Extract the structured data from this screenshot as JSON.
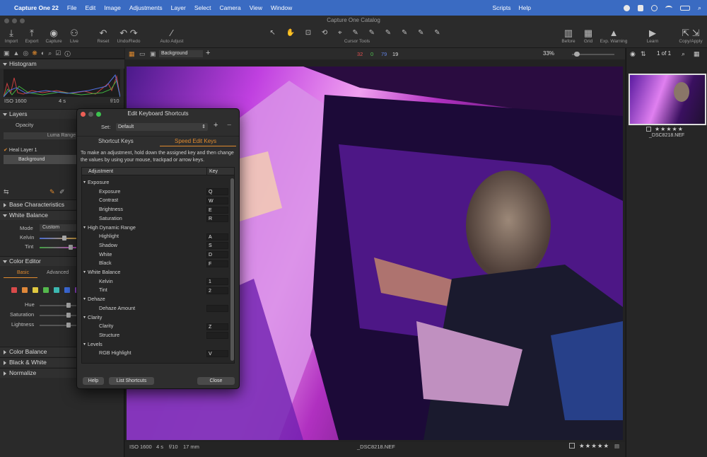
{
  "menubar": {
    "app": "Capture One 22",
    "items": [
      "File",
      "Edit",
      "Image",
      "Adjustments",
      "Layer",
      "Select",
      "Camera",
      "View",
      "Window"
    ],
    "right_items": [
      "Scripts",
      "Help"
    ]
  },
  "window": {
    "title": "Capture One Catalog"
  },
  "toolbar": {
    "import": "Import",
    "export": "Export",
    "capture": "Capture",
    "live": "Live",
    "reset": "Reset",
    "undo_redo": "Undo/Redo",
    "auto_adjust": "Auto Adjust",
    "cursor_tools": "Cursor Tools",
    "before": "Before",
    "grid": "Grid",
    "exp_warning": "Exp. Warning",
    "learn": "Learn",
    "copy_apply": "Copy/Apply"
  },
  "viewer_header": {
    "layer_select": "Background",
    "r": "32",
    "g": "0",
    "b": "79",
    "l": "19",
    "zoom": "33%",
    "count": "1 of 1"
  },
  "left": {
    "histogram": {
      "title": "Histogram",
      "iso": "ISO 1600",
      "shutter": "4 s",
      "aperture": "f/10"
    },
    "layers": {
      "title": "Layers",
      "opacity": "Opacity",
      "luma": "Luma Range",
      "items": [
        "Heal Layer 1",
        "Background"
      ]
    },
    "base": "Base Characteristics",
    "wb": {
      "title": "White Balance",
      "mode_label": "Mode",
      "mode": "Custom",
      "kelvin": "Kelvin",
      "tint": "Tint"
    },
    "color_editor": {
      "title": "Color Editor",
      "tabs": [
        "Basic",
        "Advanced"
      ],
      "hue": "Hue",
      "saturation": "Saturation",
      "lightness": "Lightness"
    },
    "color_balance": "Color Balance",
    "bw": "Black & White",
    "normalize": "Normalize"
  },
  "swatches": [
    "#d94a4a",
    "#e0883a",
    "#e0c840",
    "#54b84c",
    "#3cb8b0",
    "#3c6ad8",
    "#9a4ad8"
  ],
  "status": {
    "iso": "ISO 1600",
    "shutter": "4 s",
    "aperture": "f/10",
    "focal": "17 mm",
    "filename": "_DSC8218.NEF"
  },
  "thumb": {
    "filename": "_DSC8218.NEF",
    "stars": "★★★★★"
  },
  "dialog": {
    "title": "Edit Keyboard Shortcuts",
    "set_label": "Set:",
    "set_value": "Default",
    "tab1": "Shortcut Keys",
    "tab2": "Speed Edit Keys",
    "desc": "To make an adjustment, hold down the assigned key and then change the values by using your mouse, trackpad or arrow keys.",
    "col_adj": "Adjustment",
    "col_key": "Key",
    "rows": [
      {
        "label": "Exposure",
        "group": true,
        "key": ""
      },
      {
        "label": "Exposure",
        "key": "Q"
      },
      {
        "label": "Contrast",
        "key": "W"
      },
      {
        "label": "Brightness",
        "key": "E"
      },
      {
        "label": "Saturation",
        "key": "R"
      },
      {
        "label": "High Dynamic Range",
        "group": true,
        "key": ""
      },
      {
        "label": "Highlight",
        "key": "A"
      },
      {
        "label": "Shadow",
        "key": "S"
      },
      {
        "label": "White",
        "key": "D"
      },
      {
        "label": "Black",
        "key": "F"
      },
      {
        "label": "White Balance",
        "group": true,
        "key": ""
      },
      {
        "label": "Kelvin",
        "key": "1"
      },
      {
        "label": "Tint",
        "key": "2"
      },
      {
        "label": "Dehaze",
        "group": true,
        "key": ""
      },
      {
        "label": "Dehaze Amount",
        "key": ""
      },
      {
        "label": "Clarity",
        "group": true,
        "key": ""
      },
      {
        "label": "Clarity",
        "key": "Z"
      },
      {
        "label": "Structure",
        "key": ""
      },
      {
        "label": "Levels",
        "group": true,
        "key": ""
      },
      {
        "label": "RGB Highlight",
        "key": "V"
      }
    ],
    "help": "Help",
    "list": "List Shortcuts",
    "close": "Close"
  }
}
